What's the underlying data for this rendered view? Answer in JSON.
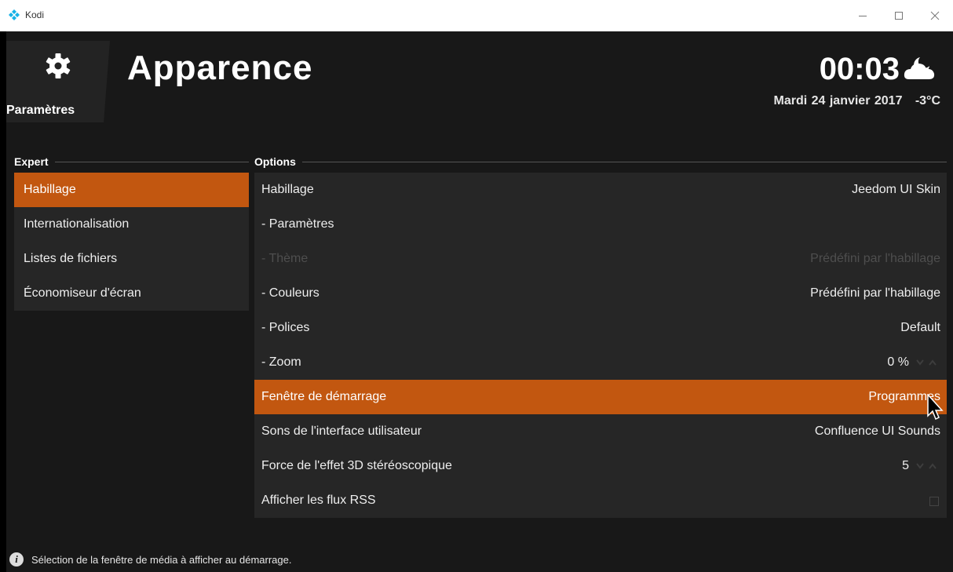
{
  "window": {
    "title": "Kodi",
    "icons": {
      "logo": "kodi-logo-icon",
      "minimize": "minimize-icon",
      "maximize": "maximize-icon",
      "close": "close-icon"
    }
  },
  "header": {
    "section_label": "Paramètres",
    "page_title": "Apparence",
    "clock": "00:03",
    "date": "Mardi 24 janvier 2017",
    "temperature": "-3°C",
    "weather_icon": "cloud-moon-icon"
  },
  "sidebar": {
    "heading": "Expert",
    "items": [
      {
        "label": "Habillage",
        "active": true
      },
      {
        "label": "Internationalisation"
      },
      {
        "label": "Listes de fichiers"
      },
      {
        "label": "Économiseur d'écran"
      }
    ]
  },
  "options": {
    "heading": "Options",
    "rows": [
      {
        "label": "Habillage",
        "value": "Jeedom UI Skin"
      },
      {
        "label": "- Paramètres",
        "value": ""
      },
      {
        "label": "- Thème",
        "value": "Prédéfini par l'habillage",
        "disabled": true
      },
      {
        "label": "- Couleurs",
        "value": "Prédéfini par l'habillage"
      },
      {
        "label": "- Polices",
        "value": "Default"
      },
      {
        "label": "- Zoom",
        "value": "0 %",
        "spinner": true
      },
      {
        "label": "Fenêtre de démarrage",
        "value": "Programmes",
        "active": true
      },
      {
        "label": "Sons de l'interface utilisateur",
        "value": "Confluence UI Sounds"
      },
      {
        "label": "Force de l'effet 3D stéréoscopique",
        "value": "5",
        "spinner": true
      },
      {
        "label": "Afficher les flux RSS",
        "value": "",
        "checkbox": true
      }
    ]
  },
  "footer": {
    "hint": "Sélection de la fenêtre de média à afficher au démarrage."
  },
  "colors": {
    "accent": "#c25710",
    "background": "#181818",
    "panel": "#262626"
  }
}
